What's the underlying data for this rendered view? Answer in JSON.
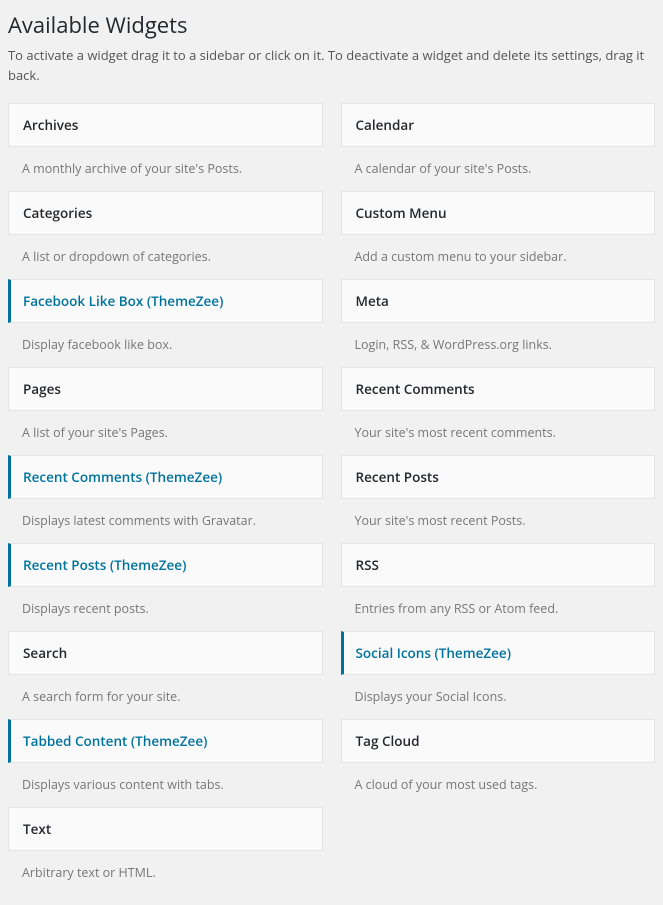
{
  "title": "Available Widgets",
  "description": "To activate a widget drag it to a sidebar or click on it. To deactivate a widget and delete its settings, drag it back.",
  "left": [
    {
      "name": "Archives",
      "desc": "A monthly archive of your site's Posts.",
      "themed": false
    },
    {
      "name": "Categories",
      "desc": "A list or dropdown of categories.",
      "themed": false
    },
    {
      "name": "Facebook Like Box (ThemeZee)",
      "desc": "Display facebook like box.",
      "themed": true
    },
    {
      "name": "Pages",
      "desc": "A list of your site's Pages.",
      "themed": false
    },
    {
      "name": "Recent Comments (ThemeZee)",
      "desc": "Displays latest comments with Gravatar.",
      "themed": true
    },
    {
      "name": "Recent Posts (ThemeZee)",
      "desc": "Displays recent posts.",
      "themed": true
    },
    {
      "name": "Search",
      "desc": "A search form for your site.",
      "themed": false
    },
    {
      "name": "Tabbed Content (ThemeZee)",
      "desc": "Displays various content with tabs.",
      "themed": true
    },
    {
      "name": "Text",
      "desc": "Arbitrary text or HTML.",
      "themed": false
    }
  ],
  "right": [
    {
      "name": "Calendar",
      "desc": "A calendar of your site's Posts.",
      "themed": false
    },
    {
      "name": "Custom Menu",
      "desc": "Add a custom menu to your sidebar.",
      "themed": false
    },
    {
      "name": "Meta",
      "desc": "Login, RSS, & WordPress.org links.",
      "themed": false
    },
    {
      "name": "Recent Comments",
      "desc": "Your site's most recent comments.",
      "themed": false
    },
    {
      "name": "Recent Posts",
      "desc": "Your site's most recent Posts.",
      "themed": false
    },
    {
      "name": "RSS",
      "desc": "Entries from any RSS or Atom feed.",
      "themed": false
    },
    {
      "name": "Social Icons (ThemeZee)",
      "desc": "Displays your Social Icons.",
      "themed": true
    },
    {
      "name": "Tag Cloud",
      "desc": "A cloud of your most used tags.",
      "themed": false
    }
  ]
}
